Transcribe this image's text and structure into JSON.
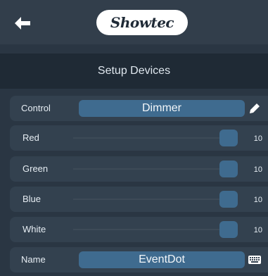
{
  "header": {
    "logo_part1": "Show",
    "logo_part2": "tec"
  },
  "page": {
    "title": "Setup Devices"
  },
  "control": {
    "label": "Control",
    "value": "Dimmer"
  },
  "sliders": [
    {
      "label": "Red",
      "value": "10"
    },
    {
      "label": "Green",
      "value": "10"
    },
    {
      "label": "Blue",
      "value": "10"
    },
    {
      "label": "White",
      "value": "10"
    }
  ],
  "name": {
    "label": "Name",
    "value": "EventDot"
  },
  "icons": {
    "back": "arrow-left-icon",
    "edit": "pencil-icon",
    "keyboard": "keyboard-icon"
  },
  "colors": {
    "background": "#2a3643",
    "header": "#323e4b",
    "title_bar": "#1f2a35",
    "row": "#33414f",
    "accent": "#3f6b8f"
  }
}
